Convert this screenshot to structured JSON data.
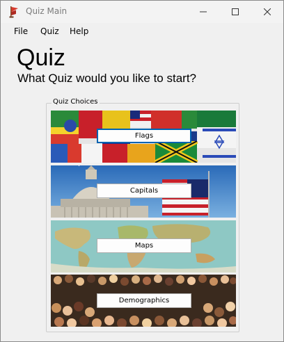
{
  "window": {
    "title": "Quiz Main"
  },
  "menu": {
    "items": [
      "File",
      "Quiz",
      "Help"
    ]
  },
  "main": {
    "heading": "Quiz",
    "subheading": "What Quiz would you like to start?"
  },
  "quiz_choices": {
    "group_label": "Quiz Choices",
    "buttons": [
      "Flags",
      "Capitals",
      "Maps",
      "Demographics"
    ]
  },
  "icons": {
    "app": "quiz-flag-icon",
    "minimize": "minimize-icon",
    "maximize": "maximize-icon",
    "close": "close-icon"
  },
  "colors": {
    "focus_border": "#0063b1",
    "titlebar_bg": "#f3f3f3",
    "window_bg": "#f0f0f0"
  }
}
